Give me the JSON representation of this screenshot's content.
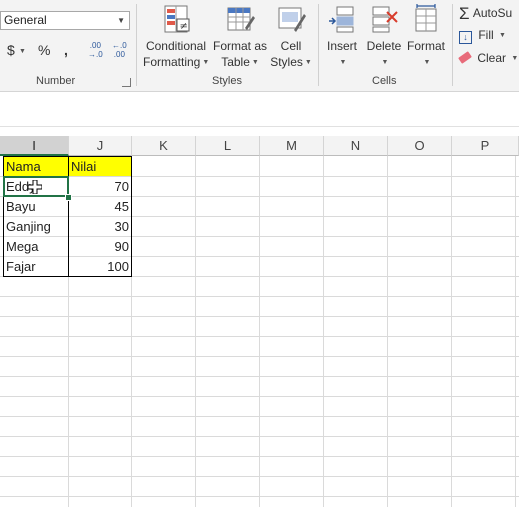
{
  "ribbon": {
    "number": {
      "format_value": "General",
      "currency_symbol": "$",
      "percent_symbol": "%",
      "comma_symbol": ",",
      "increase_decimal": [
        ".00",
        "→.0"
      ],
      "decrease_decimal": [
        "←.0",
        ".00"
      ],
      "group_label": "Number"
    },
    "styles": {
      "conditional_formatting": [
        "Conditional",
        "Formatting"
      ],
      "format_as_table": [
        "Format as",
        "Table"
      ],
      "cell_styles": [
        "Cell",
        "Styles"
      ],
      "group_label": "Styles"
    },
    "cells": {
      "insert": "Insert",
      "delete": "Delete",
      "format": "Format",
      "group_label": "Cells"
    },
    "editing": {
      "autosum": "AutoSu",
      "fill": "Fill",
      "clear": "Clear"
    }
  },
  "columns": [
    "I",
    "J",
    "K",
    "L",
    "M",
    "N",
    "O",
    "P"
  ],
  "selected_column": "I",
  "table": {
    "headers": [
      "Nama",
      "Nilai"
    ],
    "rows": [
      {
        "name": "Eddy",
        "value": "70"
      },
      {
        "name": "Bayu",
        "value": "45"
      },
      {
        "name": "Ganjing",
        "value": "30"
      },
      {
        "name": "Mega",
        "value": "90"
      },
      {
        "name": "Fajar",
        "value": "100"
      }
    ]
  },
  "colors": {
    "header_fill": "#ffff00",
    "selection": "#217346",
    "accent_icon": "#2b579a"
  }
}
